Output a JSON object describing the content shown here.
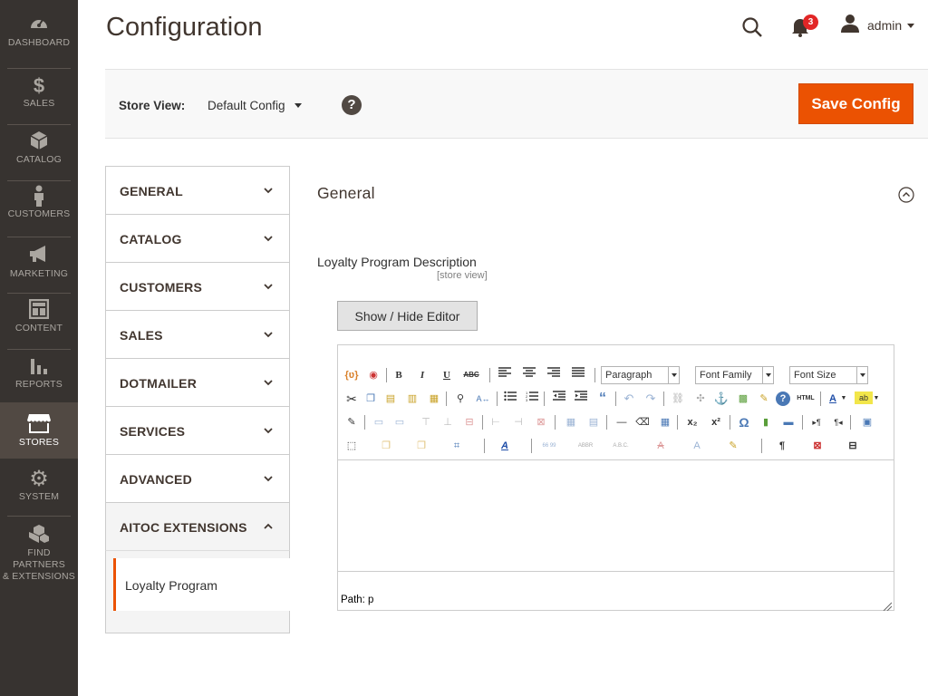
{
  "sidebar": {
    "items": [
      {
        "label": "DASHBOARD",
        "icon": "dashboard-icon",
        "glyph": "◔"
      },
      {
        "label": "SALES",
        "icon": "dollar-icon",
        "glyph": "$"
      },
      {
        "label": "CATALOG",
        "icon": "box-icon",
        "glyph": "▣"
      },
      {
        "label": "CUSTOMERS",
        "icon": "person-icon",
        "glyph": "♟"
      },
      {
        "label": "MARKETING",
        "icon": "megaphone-icon",
        "glyph": "📣"
      },
      {
        "label": "CONTENT",
        "icon": "layout-icon",
        "glyph": "▤"
      },
      {
        "label": "REPORTS",
        "icon": "bar-chart-icon",
        "glyph": "▮"
      },
      {
        "label": "STORES",
        "icon": "store-icon",
        "glyph": "⌂"
      },
      {
        "label": "SYSTEM",
        "icon": "gear-icon",
        "glyph": "⚙"
      },
      {
        "label": "FIND PARTNERS",
        "label2": "& EXTENSIONS",
        "icon": "cubes-icon",
        "glyph": "❖"
      }
    ],
    "active": "STORES"
  },
  "header": {
    "title": "Configuration",
    "notifications_count": "3",
    "user_name": "admin"
  },
  "store_bar": {
    "label": "Store View:",
    "selected": "Default Config",
    "help": "?",
    "save_label": "Save Config"
  },
  "tabs": [
    {
      "label": "GENERAL"
    },
    {
      "label": "CATALOG"
    },
    {
      "label": "CUSTOMERS"
    },
    {
      "label": "SALES"
    },
    {
      "label": "DOTMAILER"
    },
    {
      "label": "SERVICES"
    },
    {
      "label": "ADVANCED"
    },
    {
      "label": "AITOC EXTENSIONS",
      "open": true
    }
  ],
  "sub_tab": {
    "label": "Loyalty Program"
  },
  "section": {
    "title": "General",
    "field_label": "Loyalty Program Description",
    "field_scope": "[store view]",
    "toggle_label": "Show / Hide Editor"
  },
  "editor": {
    "format_select": "Paragraph",
    "font_family_select": "Font Family",
    "font_size_select": "Font Size",
    "status_path": "Path: p",
    "body_text": ""
  },
  "colors": {
    "sidebar_bg": "#373330",
    "sidebar_active": "#514943",
    "accent": "#eb5202",
    "badge": "#e22626"
  }
}
